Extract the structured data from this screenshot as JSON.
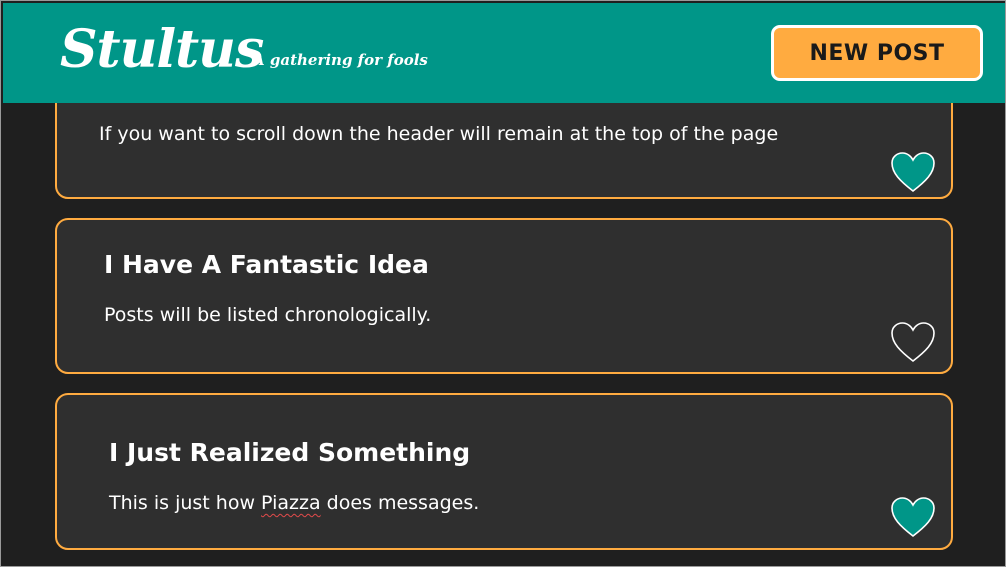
{
  "header": {
    "logo": "Stultus",
    "tagline": "A gathering for fools",
    "new_post_label": "NEW POST"
  },
  "colors": {
    "header_bg": "#009688",
    "accent": "#ffab40",
    "page_bg": "#1f1f1f",
    "card_bg": "#2f2f2f",
    "heart_liked": "#009688"
  },
  "posts": [
    {
      "title": "",
      "body": "If you want to scroll down the header will remain at the top of the page",
      "liked": true
    },
    {
      "title": "I Have A Fantastic Idea",
      "body": "Posts will be listed chronologically.",
      "liked": false
    },
    {
      "title": "I Just Realized Something",
      "body_prefix": "This is just how ",
      "body_misspelled": "Piazza",
      "body_suffix": " does messages.",
      "liked": true
    }
  ]
}
